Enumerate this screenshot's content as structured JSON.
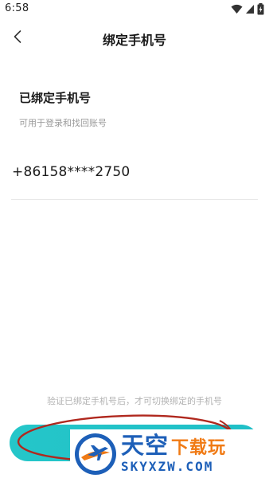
{
  "status_bar": {
    "time": "6:58",
    "icons": [
      "wifi-icon",
      "cellular-icon",
      "battery-charging-icon"
    ]
  },
  "nav": {
    "back_icon": "chevron-left-icon",
    "title": "绑定手机号"
  },
  "bound_section": {
    "title": "已绑定手机号",
    "subtitle": "可用于登录和找回账号",
    "phone": "+86158****2750"
  },
  "footer": {
    "hint": "验证已绑定手机号后，才可切换绑定的手机号",
    "button_label": ""
  },
  "watermark": {
    "brand_main": "天空",
    "brand_accent": "下载玩",
    "domain": "SKYXZW.COM"
  },
  "colors": {
    "accent": "#25c6c9",
    "annotation": "#b0281e",
    "watermark_blue": "#1d5fb8",
    "watermark_orange": "#f07a14"
  }
}
